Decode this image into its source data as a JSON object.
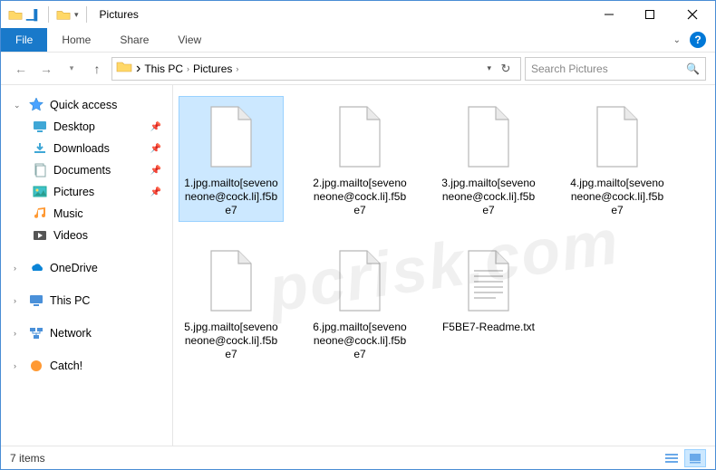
{
  "window": {
    "title": "Pictures"
  },
  "ribbon": {
    "file": "File",
    "tabs": [
      "Home",
      "Share",
      "View"
    ]
  },
  "breadcrumbs": [
    "This PC",
    "Pictures"
  ],
  "search": {
    "placeholder": "Search Pictures"
  },
  "sidebar": {
    "quick_access": "Quick access",
    "quick_items": [
      {
        "label": "Desktop",
        "icon": "desktop"
      },
      {
        "label": "Downloads",
        "icon": "downloads"
      },
      {
        "label": "Documents",
        "icon": "documents"
      },
      {
        "label": "Pictures",
        "icon": "pictures"
      },
      {
        "label": "Music",
        "icon": "music"
      },
      {
        "label": "Videos",
        "icon": "videos"
      }
    ],
    "roots": [
      {
        "label": "OneDrive",
        "icon": "onedrive"
      },
      {
        "label": "This PC",
        "icon": "thispc"
      },
      {
        "label": "Network",
        "icon": "network"
      },
      {
        "label": "Catch!",
        "icon": "catch"
      }
    ]
  },
  "files": [
    {
      "name": "1.jpg.mailto[sevenoneone@cock.li].f5be7",
      "type": "unknown",
      "selected": true
    },
    {
      "name": "2.jpg.mailto[sevenoneone@cock.li].f5be7",
      "type": "unknown",
      "selected": false
    },
    {
      "name": "3.jpg.mailto[sevenoneone@cock.li].f5be7",
      "type": "unknown",
      "selected": false
    },
    {
      "name": "4.jpg.mailto[sevenoneone@cock.li].f5be7",
      "type": "unknown",
      "selected": false
    },
    {
      "name": "5.jpg.mailto[sevenoneone@cock.li].f5be7",
      "type": "unknown",
      "selected": false
    },
    {
      "name": "6.jpg.mailto[sevenoneone@cock.li].f5be7",
      "type": "unknown",
      "selected": false
    },
    {
      "name": "F5BE7-Readme.txt",
      "type": "text",
      "selected": false
    }
  ],
  "status": {
    "item_count": "7 items"
  },
  "watermark": "pcrisk.com",
  "colors": {
    "accent": "#1979ca",
    "selection_bg": "#cce8ff",
    "selection_border": "#99d1ff"
  }
}
